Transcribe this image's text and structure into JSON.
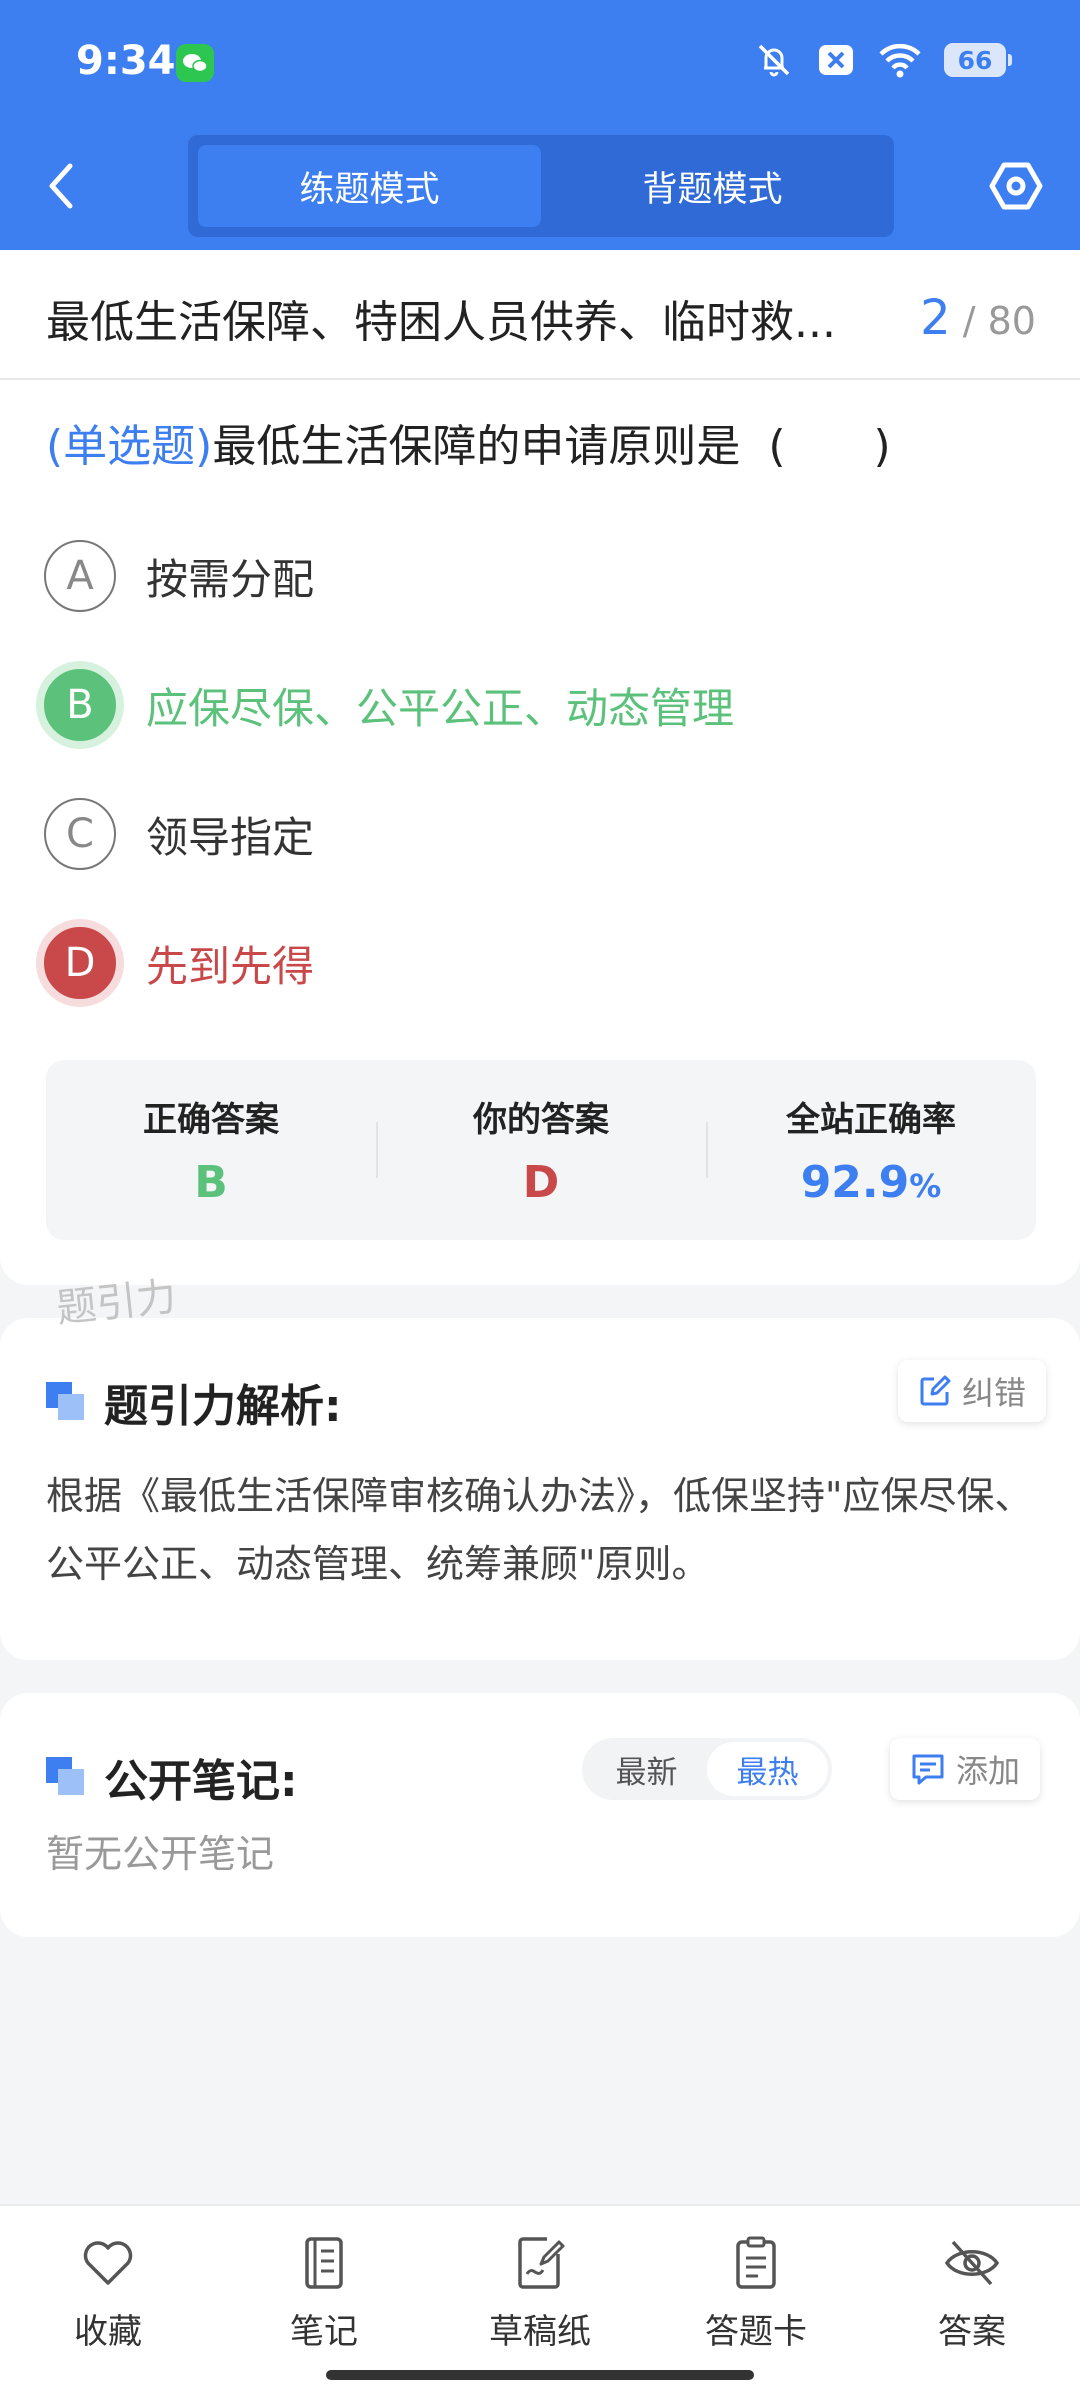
{
  "status_bar": {
    "time": "9:34",
    "battery": "66"
  },
  "header": {
    "tabs": [
      {
        "label": "练题模式",
        "active": true
      },
      {
        "label": "背题模式",
        "active": false
      }
    ]
  },
  "question_card": {
    "section_title": "最低生活保障、特困人员供养、临时救...",
    "current": "2",
    "total": "/ 80",
    "question_type": "(单选题)",
    "question_text": "最低生活保障的申请原则是",
    "blank": "(　　)",
    "options": [
      {
        "letter": "A",
        "text": "按需分配",
        "state": "normal"
      },
      {
        "letter": "B",
        "text": "应保尽保、公平公正、动态管理",
        "state": "correct"
      },
      {
        "letter": "C",
        "text": "领导指定",
        "state": "normal"
      },
      {
        "letter": "D",
        "text": "先到先得",
        "state": "wrong"
      }
    ],
    "stats": {
      "correct_label": "正确答案",
      "correct_value": "B",
      "yours_label": "你的答案",
      "yours_value": "D",
      "rate_label": "全站正确率",
      "rate_value": "92.9",
      "rate_unit": "%"
    },
    "watermark": "题引力"
  },
  "analysis": {
    "title": "题引力解析:",
    "correct_button": "纠错",
    "text": "根据《最低生活保障审核确认办法》，低保坚持\"应保尽保、公平公正、动态管理、统筹兼顾\"原则。"
  },
  "notes": {
    "title": "公开笔记:",
    "sort_tabs": [
      {
        "label": "最新",
        "active": false
      },
      {
        "label": "最热",
        "active": true
      }
    ],
    "add_button": "添加",
    "empty_text": "暂无公开笔记"
  },
  "bottom_bar": {
    "items": [
      {
        "label": "收藏",
        "icon": "heart-icon"
      },
      {
        "label": "笔记",
        "icon": "notebook-icon"
      },
      {
        "label": "草稿纸",
        "icon": "draft-paper-icon"
      },
      {
        "label": "答题卡",
        "icon": "answer-card-icon"
      },
      {
        "label": "答案",
        "icon": "eye-off-icon"
      }
    ]
  },
  "colors": {
    "primary": "#3d7ef0",
    "correct": "#5cc27b",
    "wrong": "#c9494b"
  }
}
